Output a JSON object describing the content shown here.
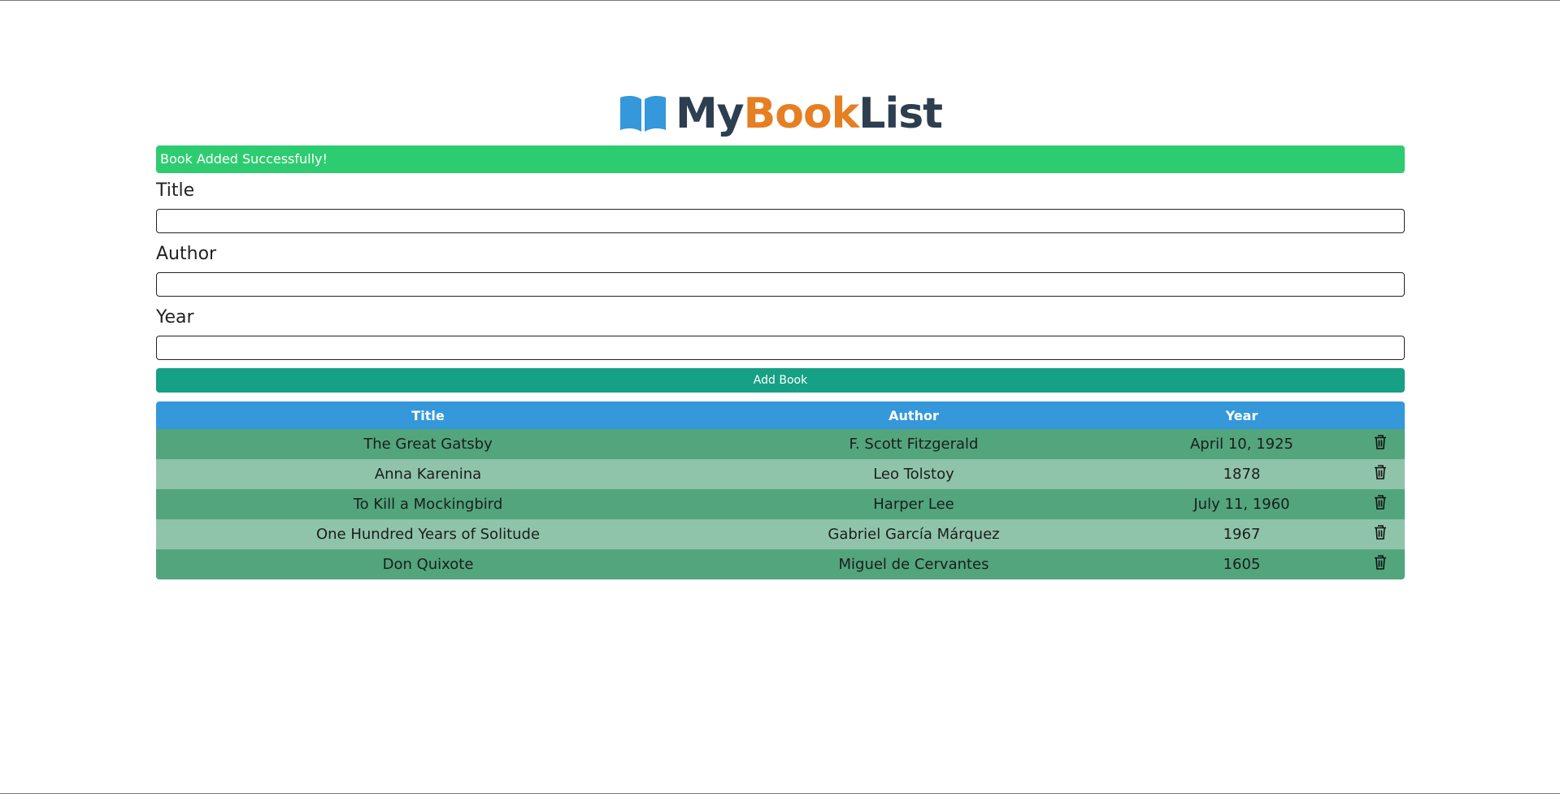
{
  "app": {
    "logo_parts": {
      "my": "My",
      "book": "Book",
      "list": "List"
    },
    "logo_icon": "open-book-icon",
    "brand_colors": {
      "dark": "#2c3e50",
      "accent": "#e67e22",
      "icon": "#3498db"
    }
  },
  "alert": {
    "message": "Book Added Successfully!",
    "color": "#2ecc71"
  },
  "form": {
    "title_label": "Title",
    "title_value": "",
    "author_label": "Author",
    "author_value": "",
    "year_label": "Year",
    "year_value": "",
    "submit_label": "Add Book",
    "submit_color": "#16a085"
  },
  "table": {
    "header_color": "#3498db",
    "columns": [
      "Title",
      "Author",
      "Year",
      ""
    ],
    "delete_icon": "trash-icon",
    "rows": [
      {
        "title": "The Great Gatsby",
        "author": "F. Scott Fitzgerald",
        "year": "April 10, 1925"
      },
      {
        "title": "Anna Karenina",
        "author": "Leo Tolstoy",
        "year": "1878"
      },
      {
        "title": "To Kill a Mockingbird",
        "author": "Harper Lee",
        "year": "July 11, 1960"
      },
      {
        "title": "One Hundred Years of Solitude",
        "author": "Gabriel García Márquez",
        "year": "1967"
      },
      {
        "title": "Don Quixote",
        "author": "Miguel de Cervantes",
        "year": "1605"
      }
    ]
  }
}
